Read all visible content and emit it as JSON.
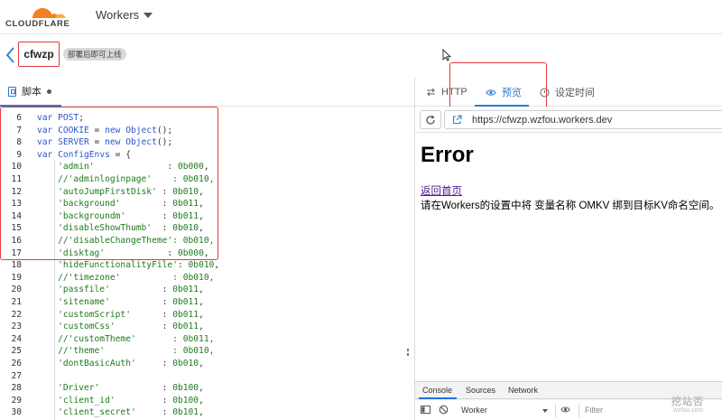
{
  "brand": {
    "name": "CLOUDFLARE",
    "accent": "#f48120"
  },
  "nav": {
    "section": "Workers"
  },
  "worker": {
    "name": "cfwzp",
    "badge": "部署后即可上线"
  },
  "editor": {
    "tab_label": "脚本",
    "lines": [
      {
        "n": "6",
        "t": [
          [
            "kw",
            "var "
          ],
          [
            "vr",
            "POST"
          ],
          [
            "op",
            ";"
          ]
        ]
      },
      {
        "n": "7",
        "t": [
          [
            "kw",
            "var "
          ],
          [
            "vr",
            "COOKIE"
          ],
          [
            "op",
            " = "
          ],
          [
            "kw",
            "new "
          ],
          [
            "vr",
            "Object"
          ],
          [
            "op",
            "();"
          ]
        ]
      },
      {
        "n": "8",
        "t": [
          [
            "kw",
            "var "
          ],
          [
            "vr",
            "SERVER"
          ],
          [
            "op",
            " = "
          ],
          [
            "kw",
            "new "
          ],
          [
            "vr",
            "Object"
          ],
          [
            "op",
            "();"
          ]
        ]
      },
      {
        "n": "9",
        "t": [
          [
            "kw",
            "var "
          ],
          [
            "vr",
            "ConfigEnvs"
          ],
          [
            "op",
            " = {"
          ]
        ]
      },
      {
        "n": "10",
        "t": [
          [
            "str",
            "    'admin'"
          ],
          [
            "op",
            "              : "
          ],
          [
            "num",
            "0b000"
          ],
          [
            "op",
            ","
          ]
        ]
      },
      {
        "n": "11",
        "t": [
          [
            "cm",
            "    //'adminloginpage'    : 0b010,"
          ]
        ]
      },
      {
        "n": "12",
        "t": [
          [
            "str",
            "    'autoJumpFirstDisk'"
          ],
          [
            "op",
            " : "
          ],
          [
            "num",
            "0b010"
          ],
          [
            "op",
            ","
          ]
        ]
      },
      {
        "n": "13",
        "t": [
          [
            "str",
            "    'background'"
          ],
          [
            "op",
            "        : "
          ],
          [
            "num",
            "0b011"
          ],
          [
            "op",
            ","
          ]
        ]
      },
      {
        "n": "14",
        "t": [
          [
            "str",
            "    'backgroundm'"
          ],
          [
            "op",
            "       : "
          ],
          [
            "num",
            "0b011"
          ],
          [
            "op",
            ","
          ]
        ]
      },
      {
        "n": "15",
        "t": [
          [
            "str",
            "    'disableShowThumb'"
          ],
          [
            "op",
            "  : "
          ],
          [
            "num",
            "0b010"
          ],
          [
            "op",
            ","
          ]
        ]
      },
      {
        "n": "16",
        "t": [
          [
            "cm",
            "    //'disableChangeTheme': 0b010,"
          ]
        ]
      },
      {
        "n": "17",
        "t": [
          [
            "str",
            "    'disktag'"
          ],
          [
            "op",
            "            : "
          ],
          [
            "num",
            "0b000"
          ],
          [
            "op",
            ","
          ]
        ]
      },
      {
        "n": "18",
        "t": [
          [
            "str",
            "    'hideFunctionalityFile'"
          ],
          [
            "op",
            ": "
          ],
          [
            "num",
            "0b010"
          ],
          [
            "op",
            ","
          ]
        ]
      },
      {
        "n": "19",
        "t": [
          [
            "cm",
            "    //'timezone'          : 0b010,"
          ]
        ]
      },
      {
        "n": "20",
        "t": [
          [
            "str",
            "    'passfile'"
          ],
          [
            "op",
            "          : "
          ],
          [
            "num",
            "0b011"
          ],
          [
            "op",
            ","
          ]
        ]
      },
      {
        "n": "21",
        "t": [
          [
            "str",
            "    'sitename'"
          ],
          [
            "op",
            "          : "
          ],
          [
            "num",
            "0b011"
          ],
          [
            "op",
            ","
          ]
        ]
      },
      {
        "n": "22",
        "t": [
          [
            "str",
            "    'customScript'"
          ],
          [
            "op",
            "      : "
          ],
          [
            "num",
            "0b011"
          ],
          [
            "op",
            ","
          ]
        ]
      },
      {
        "n": "23",
        "t": [
          [
            "str",
            "    'customCss'"
          ],
          [
            "op",
            "         : "
          ],
          [
            "num",
            "0b011"
          ],
          [
            "op",
            ","
          ]
        ]
      },
      {
        "n": "24",
        "t": [
          [
            "cm",
            "    //'customTheme'       : 0b011,"
          ]
        ]
      },
      {
        "n": "25",
        "t": [
          [
            "cm",
            "    //'theme'             : 0b010,"
          ]
        ]
      },
      {
        "n": "26",
        "t": [
          [
            "str",
            "    'dontBasicAuth'"
          ],
          [
            "op",
            "     : "
          ],
          [
            "num",
            "0b010"
          ],
          [
            "op",
            ","
          ]
        ]
      },
      {
        "n": "27",
        "t": []
      },
      {
        "n": "28",
        "t": [
          [
            "str",
            "    'Driver'"
          ],
          [
            "op",
            "            : "
          ],
          [
            "num",
            "0b100"
          ],
          [
            "op",
            ","
          ]
        ]
      },
      {
        "n": "29",
        "t": [
          [
            "str",
            "    'client_id'"
          ],
          [
            "op",
            "         : "
          ],
          [
            "num",
            "0b100"
          ],
          [
            "op",
            ","
          ]
        ]
      },
      {
        "n": "30",
        "t": [
          [
            "str",
            "    'client_secret'"
          ],
          [
            "op",
            "     : "
          ],
          [
            "num",
            "0b101"
          ],
          [
            "op",
            ","
          ]
        ]
      }
    ]
  },
  "preview": {
    "tabs": {
      "http": "HTTP",
      "preview": "预览",
      "schedule": "设定时间"
    },
    "url": "https://cfwzp.wzfou.workers.dev",
    "page": {
      "title": "Error",
      "link": "返回首页",
      "message": "请在Workers的设置中将 变量名称 OMKV 绑到目标KV命名空间。"
    }
  },
  "devtools": {
    "tabs": {
      "console": "Console",
      "sources": "Sources",
      "network": "Network"
    },
    "context": "Worker",
    "filter_placeholder": "Filter"
  },
  "watermark": {
    "main": "挖站否",
    "sub": "wzfou.com"
  },
  "colors": {
    "highlight": "#e23b3b",
    "link_blue": "#2c7cd1"
  }
}
